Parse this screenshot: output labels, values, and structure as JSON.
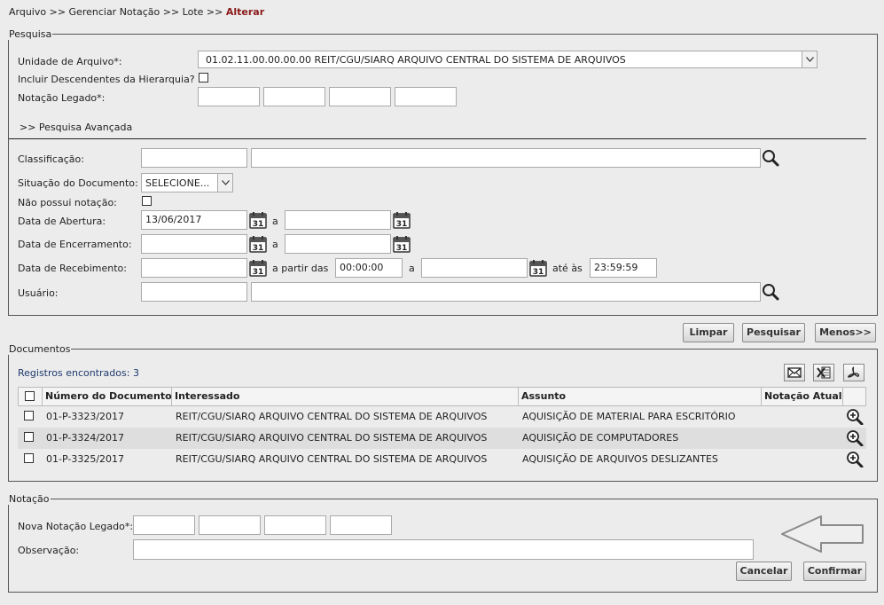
{
  "breadcrumb": {
    "trail": "Arquivo >> Gerenciar Notação >> Lote >> ",
    "current": "Alterar"
  },
  "pesquisa": {
    "legend": "Pesquisa",
    "unidade_label": "Unidade de Arquivo*:",
    "unidade_value": "01.02.11.00.00.00.00 REIT/CGU/SIARQ ARQUIVO CENTRAL DO SISTEMA DE ARQUIVOS",
    "incluir_label": "Incluir Descendentes da Hierarquia?",
    "notacao_legado_label": "Notação Legado*:",
    "avancada_label": ">> Pesquisa Avançada",
    "classificacao_label": "Classificação:",
    "situacao_label": "Situação do Documento:",
    "situacao_value": "SELECIONE...",
    "nao_possui_label": "Não possui notação:",
    "abertura_label": "Data de Abertura:",
    "abertura_value": "13/06/2017",
    "a_label": "a",
    "encerramento_label": "Data de Encerramento:",
    "recebimento_label": "Data de Recebimento:",
    "a_partir_label": "a partir das",
    "hora_inicio": "00:00:00",
    "ate_label": "até às",
    "hora_fim": "23:59:59",
    "usuario_label": "Usuário:",
    "calendar_day": "31"
  },
  "actions": {
    "limpar": "Limpar",
    "pesquisar": "Pesquisar",
    "menos": "Menos>>"
  },
  "documentos": {
    "legend": "Documentos",
    "registros": "Registros encontrados: 3",
    "columns": [
      "Número do Documento",
      "Interessado",
      "Assunto",
      "Notação Atual"
    ],
    "rows": [
      {
        "numero": "01-P-3323/2017",
        "interessado": "REIT/CGU/SIARQ ARQUIVO CENTRAL DO SISTEMA DE ARQUIVOS",
        "assunto": "AQUISIÇÃO DE MATERIAL PARA ESCRITÓRIO",
        "notacao": ""
      },
      {
        "numero": "01-P-3324/2017",
        "interessado": "REIT/CGU/SIARQ ARQUIVO CENTRAL DO SISTEMA DE ARQUIVOS",
        "assunto": "AQUISIÇÃO DE COMPUTADORES",
        "notacao": ""
      },
      {
        "numero": "01-P-3325/2017",
        "interessado": "REIT/CGU/SIARQ ARQUIVO CENTRAL DO SISTEMA DE ARQUIVOS",
        "assunto": "AQUISIÇÃO DE ARQUIVOS DESLIZANTES",
        "notacao": ""
      }
    ],
    "export_icons": [
      "email-icon",
      "excel-icon",
      "pdf-icon"
    ]
  },
  "notacao": {
    "legend": "Notação",
    "nova_label": "Nova Notação Legado*:",
    "observacao_label": "Observação:",
    "cancelar": "Cancelar",
    "confirmar": "Confirmar"
  },
  "colors": {
    "breadcrumb_current": "#8b1a1a",
    "registros_text": "#1f3a6e",
    "row_alt": "#dedede"
  }
}
